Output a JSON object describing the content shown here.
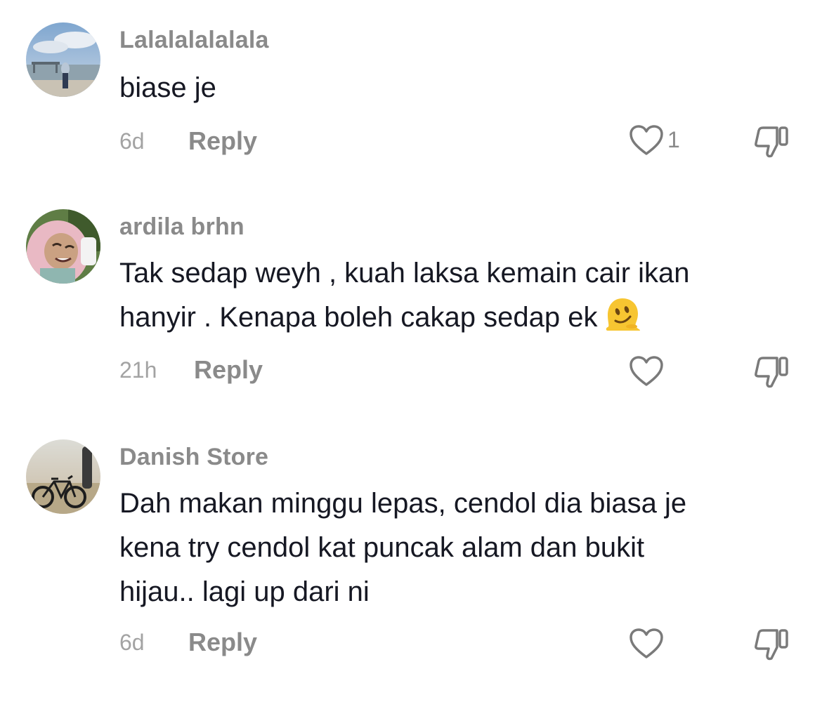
{
  "comments": [
    {
      "username": "Lalalalalalala",
      "lines": [
        "biase je"
      ],
      "time": "6d",
      "reply_label": "Reply",
      "like_count": "1",
      "avatar": "beach-photo-avatar"
    },
    {
      "username": "ardila brhn",
      "lines": [
        "Tak sedap weyh , kuah laksa kemain cair ikan",
        "hanyir . Kenapa boleh cakap sedap ek"
      ],
      "emoji": "melting-face",
      "time": "21h",
      "reply_label": "Reply",
      "like_count": "",
      "avatar": "pink-hijab-selfie-avatar"
    },
    {
      "username": "Danish Store",
      "lines": [
        "Dah makan minggu lepas, cendol dia biasa je",
        "kena try cendol kat puncak alam dan bukit",
        "hijau.. lagi up dari ni"
      ],
      "time": "6d",
      "reply_label": "Reply",
      "like_count": "",
      "avatar": "bicycle-sunset-avatar"
    }
  ],
  "icons": {
    "like": "heart-outline-icon",
    "dislike": "thumbs-down-outline-icon"
  },
  "colors": {
    "username": "#8a8a8a",
    "text": "#161823",
    "meta": "#a3a3a3",
    "icon": "#7a7a7a"
  }
}
